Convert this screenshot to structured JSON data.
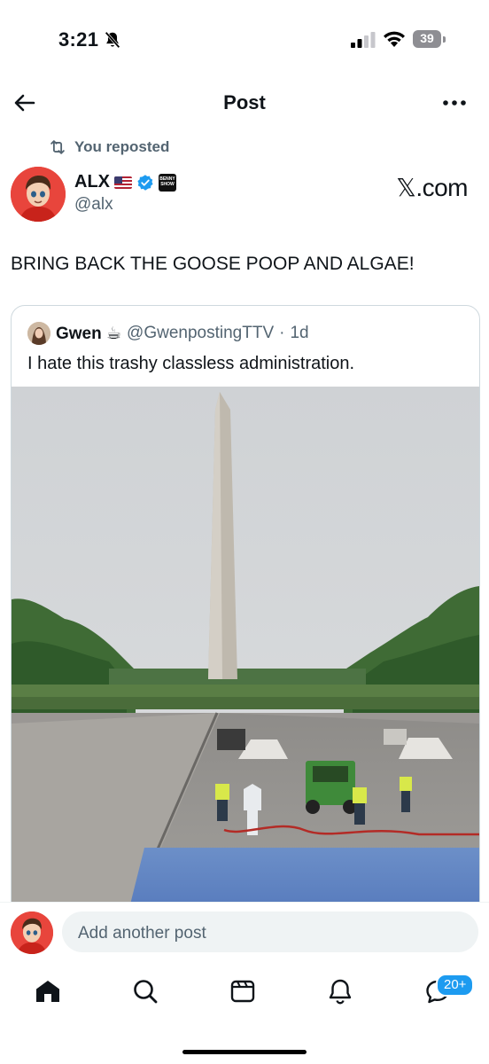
{
  "status_bar": {
    "time": "3:21",
    "battery": "39"
  },
  "header": {
    "title": "Post"
  },
  "repost": {
    "label": "You reposted"
  },
  "author": {
    "name": "ALX",
    "handle": "@alx",
    "badge_text": "BENNY SHOW"
  },
  "source_label": "𝕏.com",
  "post": {
    "text": "BRING BACK THE GOOSE POOP AND ALGAE!"
  },
  "quote": {
    "name": "Gwen ☕",
    "handle": "@GwenpostingTTV",
    "separator": "·",
    "time": "1d",
    "text": "I hate this trashy classless administration."
  },
  "reply_bar": {
    "placeholder": "Add another post"
  },
  "tabs": {
    "messages_badge": "20+"
  },
  "colors": {
    "accent": "#1d9bf0",
    "text": "#0f1419",
    "muted": "#536471",
    "border": "#cfd9de"
  },
  "icons": [
    "back-arrow-icon",
    "more-icon",
    "repost-icon",
    "us-flag-icon",
    "verified-icon",
    "home-icon",
    "search-icon",
    "grok-icon",
    "bell-icon",
    "messages-icon"
  ]
}
